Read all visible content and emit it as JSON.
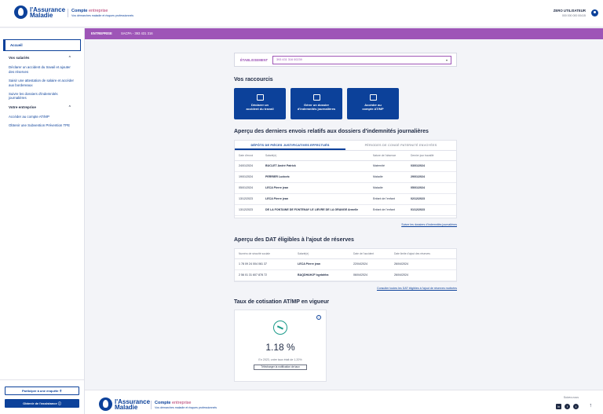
{
  "header": {
    "logo_line1": "l'Assurance",
    "logo_line2": "Maladie",
    "product_title": "Compte",
    "product_accent": "entreprise",
    "product_sub": "Vos démarches maladie et risques professionnels",
    "user_name": "ZERO UTILISATEUR",
    "user_sub": "000 000 000 00415"
  },
  "sidebar": {
    "home": "Accueil",
    "section1": "Vos salariés",
    "section1_items": [
      "Déclarer un accident du travail et ajouter des réserves",
      "Saisir une attestation de salaire et accéder aux bordereaux",
      "Suivre les dossiers d'indemnités journalières"
    ],
    "section2": "Votre entreprise",
    "section2_items": [
      "Accéder au compte AT/MP",
      "Obtenir une Subvention Prévention TPE"
    ],
    "survey_button": "Participer à une enquête",
    "help_button": "Obtenir de l'assistance"
  },
  "context_bar": {
    "label": "ENTREPRISE",
    "value": "SACPA - 393 431 316"
  },
  "establishment": {
    "label": "ÉTABLISSEMENT",
    "value": "393 431 316 00239"
  },
  "shortcuts": {
    "title": "Vos raccourcis",
    "items": [
      {
        "line1": "Déclarer un",
        "line2": "accident du travail",
        "icon": "accident-form-icon"
      },
      {
        "line1": "Gérer un dossier",
        "line2": "d'indemnités journalières",
        "icon": "folder-icon"
      },
      {
        "line1": "Accéder au",
        "line2": "compte AT/MP",
        "icon": "account-icon"
      }
    ]
  },
  "indemnities": {
    "title": "Aperçu des derniers envois relatifs aux dossiers d'indemnités journalières",
    "tabs": [
      "DÉPÔTS DE PIÈCES JUSTIFICATIVES EFFECTUÉS",
      "PÉRIODES DE CONGÉ PATERNITÉ ENVOYÉES"
    ],
    "columns": [
      "Date d'envoi",
      "Salarié(e)",
      "Nature de l'absence",
      "Dernier jour travaillé"
    ],
    "rows": [
      [
        "24/01/2024",
        "BUCLET André Patrick",
        "Maternité",
        "03/01/2024"
      ],
      [
        "19/01/2024",
        "PERRIER Ludovic",
        "Maladie",
        "29/01/2024"
      ],
      [
        "05/01/2024",
        "LECA Pierre jean",
        "Maladie",
        "05/01/2024"
      ],
      [
        "13/12/2023",
        "LECA Pierre jean",
        "Enfant de l'enfant",
        "02/12/2023"
      ],
      [
        "13/12/2023",
        "DE LA FONTAINE DE FONTENAY LE LIEVRE DE LA GRANGE Armelle",
        "Enfant de l'enfant",
        "01/12/2023"
      ]
    ],
    "link": "Suivre les dossiers d'indemnités journalières"
  },
  "dat": {
    "title": "Aperçu des DAT éligibles à l'ajout de réserves",
    "columns": [
      "Numéro de sécurité sociale",
      "Salarié(e)",
      "Date de l'accident",
      "Date limite d'ajout des réserves"
    ],
    "rows": [
      [
        "1 78 09 24 004 061 37",
        "LECA Pierre jean",
        "22/04/2024",
        "26/04/2024"
      ],
      [
        "2 56 01 31 607 878 72",
        "BAQDHAHJF Iqydahha",
        "06/04/2024",
        "26/04/2024"
      ]
    ],
    "link": "Consulter toutes les DAT éligibles à l'ajout de réserves motivées"
  },
  "rate": {
    "title": "Taux de cotisation AT/MP en vigueur",
    "value": "1.18 %",
    "text": "En 2023, votre taux était de 1.20%",
    "button": "Télécharger la notification de taux"
  },
  "footer": {
    "follow": "Suivez-nous",
    "socials": [
      "linkedin-icon",
      "facebook-icon",
      "twitter-icon"
    ]
  },
  "colors": {
    "brand": "#0c419a",
    "accent": "#9e55b7",
    "rate_icon": "#1c9b8a"
  }
}
